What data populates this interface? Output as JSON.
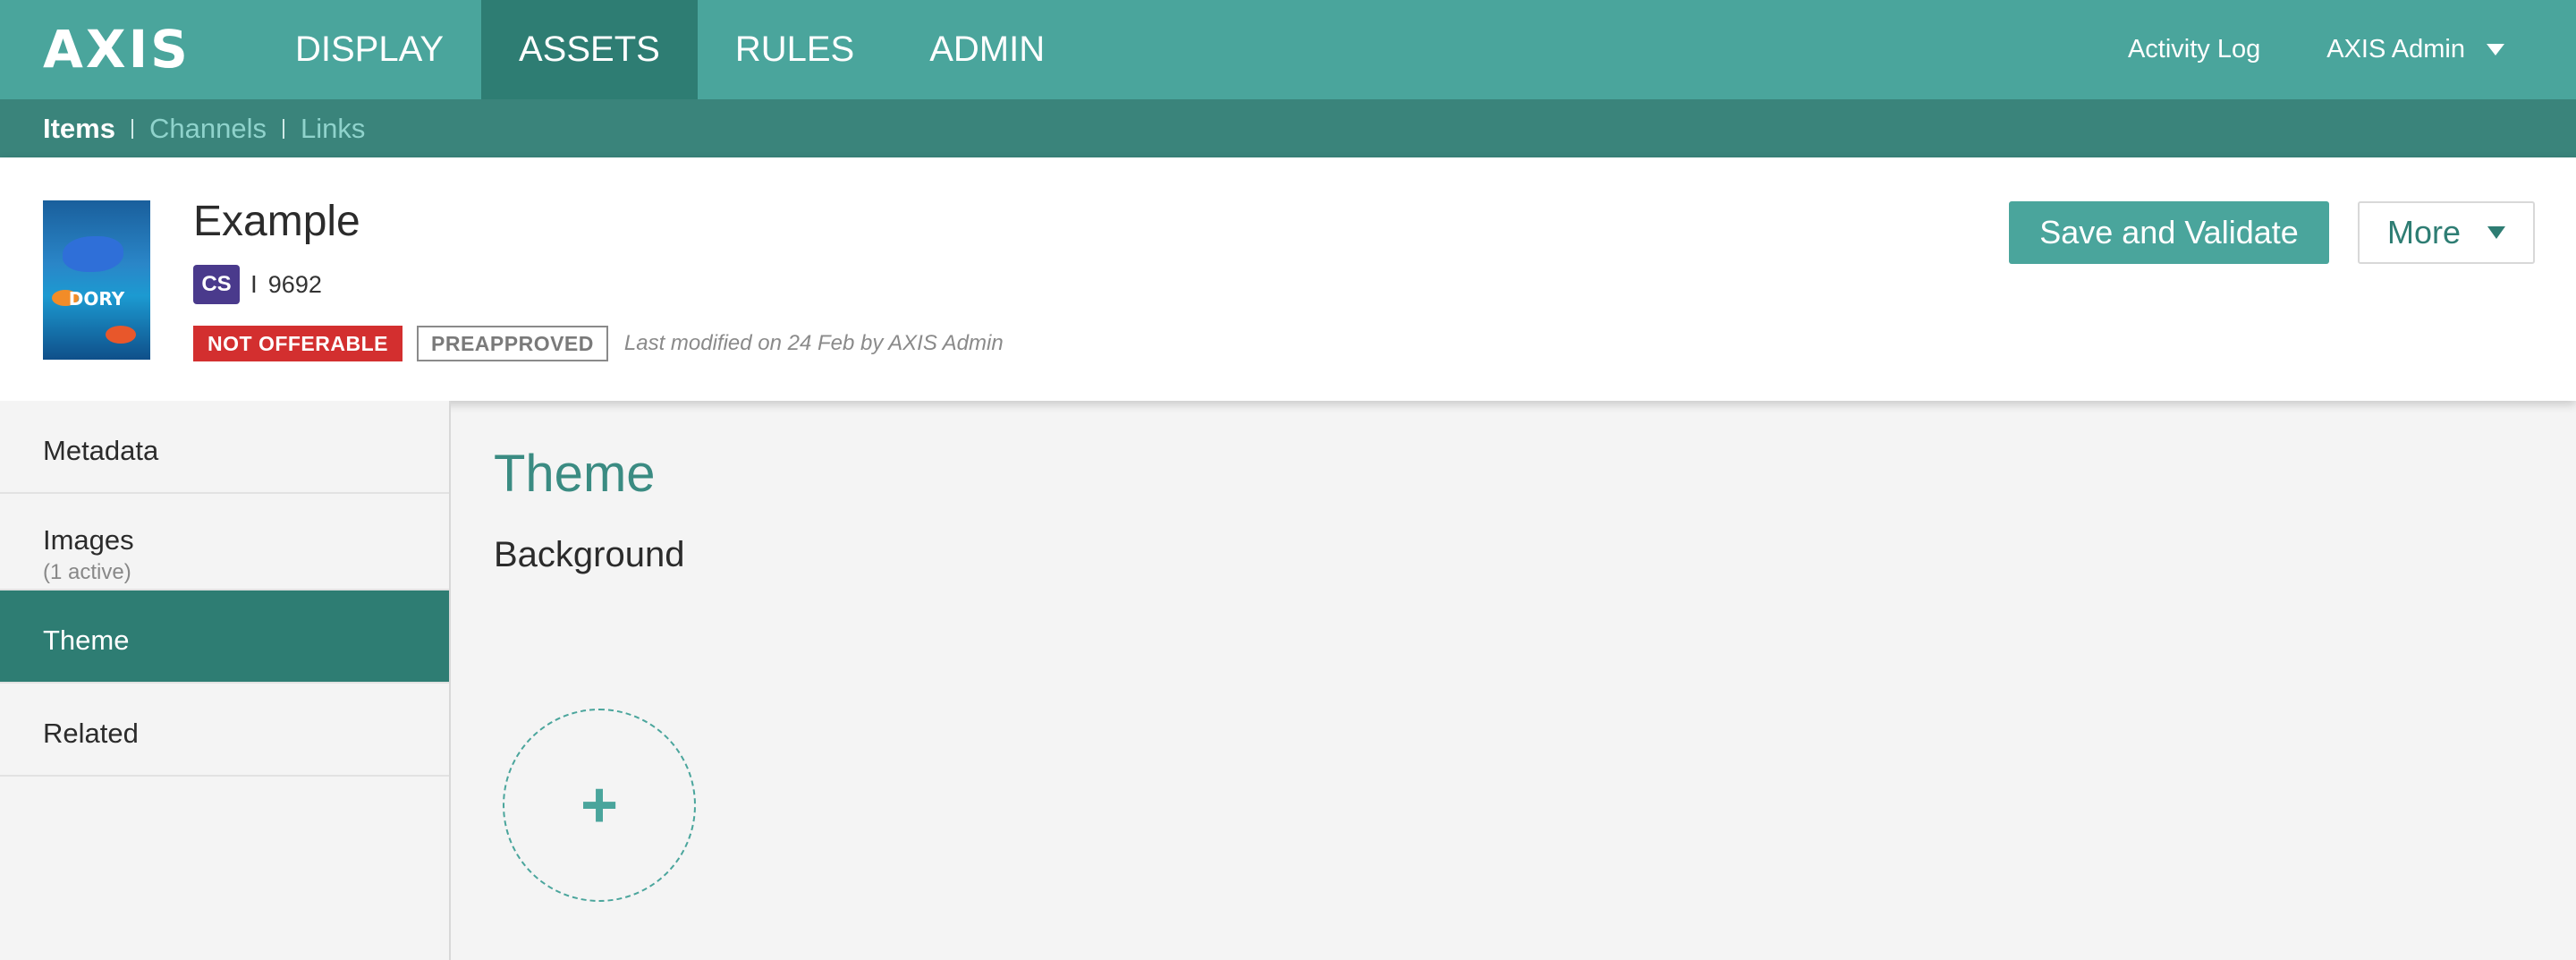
{
  "app": {
    "logo": "AXIS"
  },
  "nav": {
    "items": [
      {
        "label": "DISPLAY"
      },
      {
        "label": "ASSETS"
      },
      {
        "label": "RULES"
      },
      {
        "label": "ADMIN"
      }
    ],
    "activity_log": "Activity Log",
    "user": "AXIS Admin"
  },
  "subnav": {
    "items": [
      {
        "label": "Items"
      },
      {
        "label": "Channels"
      },
      {
        "label": "Links"
      }
    ]
  },
  "header": {
    "title": "Example",
    "poster_text": "DORY",
    "badge": "CS",
    "id": "9692",
    "status_primary": "NOT OFFERABLE",
    "status_secondary": "PREAPPROVED",
    "last_modified": "Last modified on 24 Feb by AXIS Admin",
    "save_label": "Save and Validate",
    "more_label": "More"
  },
  "sidebar": {
    "items": [
      {
        "label": "Metadata"
      },
      {
        "label": "Images",
        "sub": "(1 active)"
      },
      {
        "label": "Theme"
      },
      {
        "label": "Related"
      }
    ]
  },
  "main": {
    "title": "Theme",
    "section": "Background",
    "add_symbol": "+"
  },
  "colors": {
    "brand": "#4aa59c",
    "brand_dark": "#2e7d73",
    "alert": "#d32f2f",
    "badge": "#4a3a8c"
  }
}
